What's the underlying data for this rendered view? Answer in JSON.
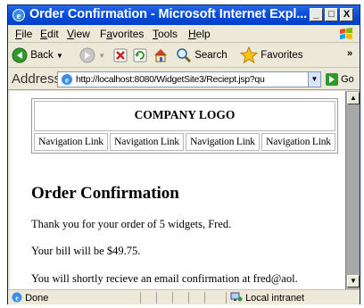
{
  "window": {
    "title": "Order Confirmation - Microsoft Internet Expl...",
    "minimize_label": "_",
    "maximize_label": "□",
    "close_label": "X"
  },
  "menu": {
    "items": [
      {
        "accel": "F",
        "rest": "ile"
      },
      {
        "accel": "E",
        "rest": "dit"
      },
      {
        "accel": "V",
        "rest": "iew"
      },
      {
        "pre": "F",
        "accel": "a",
        "rest": "vorites"
      },
      {
        "accel": "T",
        "rest": "ools"
      },
      {
        "accel": "H",
        "rest": "elp"
      }
    ]
  },
  "toolbar": {
    "back_label": "Back",
    "search_label": "Search",
    "favorites_label": "Favorites",
    "more": "»"
  },
  "address": {
    "label": "Address",
    "url": "http://localhost:8080/WidgetSite3/Reciept.jsp?qu",
    "go_label": "Go"
  },
  "page": {
    "logo_text": "COMPANY LOGO",
    "nav_links": [
      "Navigation Link",
      "Navigation Link",
      "Navigation Link",
      "Navigation Link"
    ],
    "heading": "Order Confirmation",
    "paragraphs": [
      "Thank you for your order of 5 widgets, Fred.",
      "Your bill will be $49.75.",
      "You will shortly recieve an email confirmation at fred@aol."
    ]
  },
  "status": {
    "left": "Done",
    "zone": "Local intranet"
  },
  "colors": {
    "titlebar": "#0a4fd8",
    "chrome": "#ece9d8",
    "go_arrow": "#2e9a2e"
  }
}
